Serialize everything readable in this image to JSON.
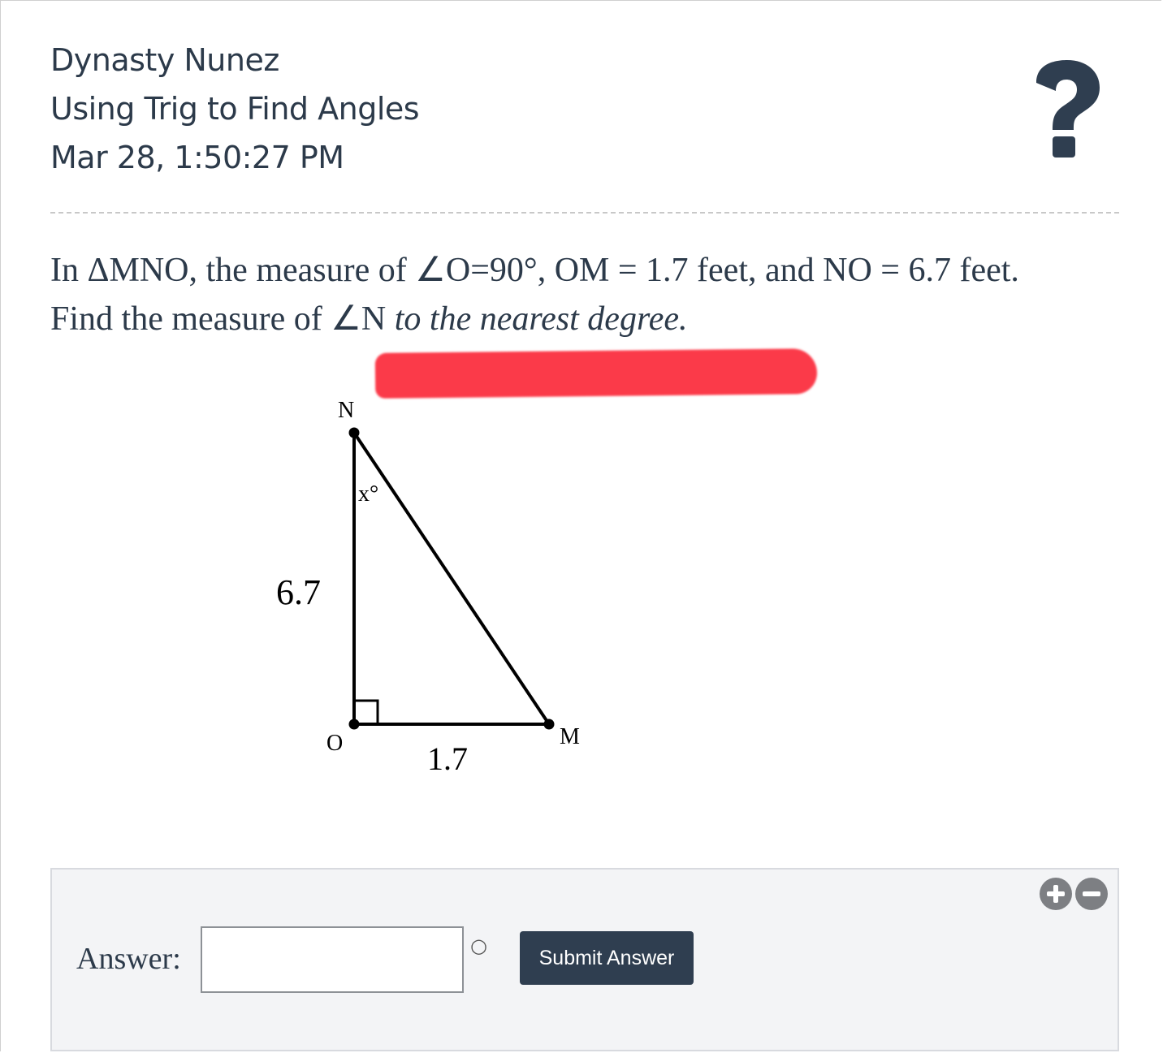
{
  "header": {
    "student_name": "Dynasty Nunez",
    "assignment_title": "Using Trig to Find Angles",
    "timestamp": "Mar 28, 1:50:27 PM",
    "help_icon": "question-mark-icon"
  },
  "question": {
    "line1": "In ΔMNO, the measure of ∠O=90°, OM = 1.7 feet, and NO = 6.7 feet.",
    "line2_plain": "Find the measure of ∠N",
    "line2_italic": " to the nearest degree."
  },
  "annotation": {
    "highlight_color": "#fb3a49"
  },
  "diagram": {
    "vertex_N": "N",
    "vertex_O": "O",
    "vertex_M": "M",
    "angle_label": "x°",
    "side_NO": "6.7",
    "side_OM": "1.7"
  },
  "answer": {
    "label": "Answer:",
    "input_value": "",
    "unit_symbol": "○",
    "submit_label": "Submit Answer",
    "zoom_in_icon": "plus-circle-icon",
    "zoom_out_icon": "minus-circle-icon"
  },
  "colors": {
    "text": "#2c3a4a",
    "button": "#2f3e50",
    "panel_bg": "#f3f4f6"
  }
}
